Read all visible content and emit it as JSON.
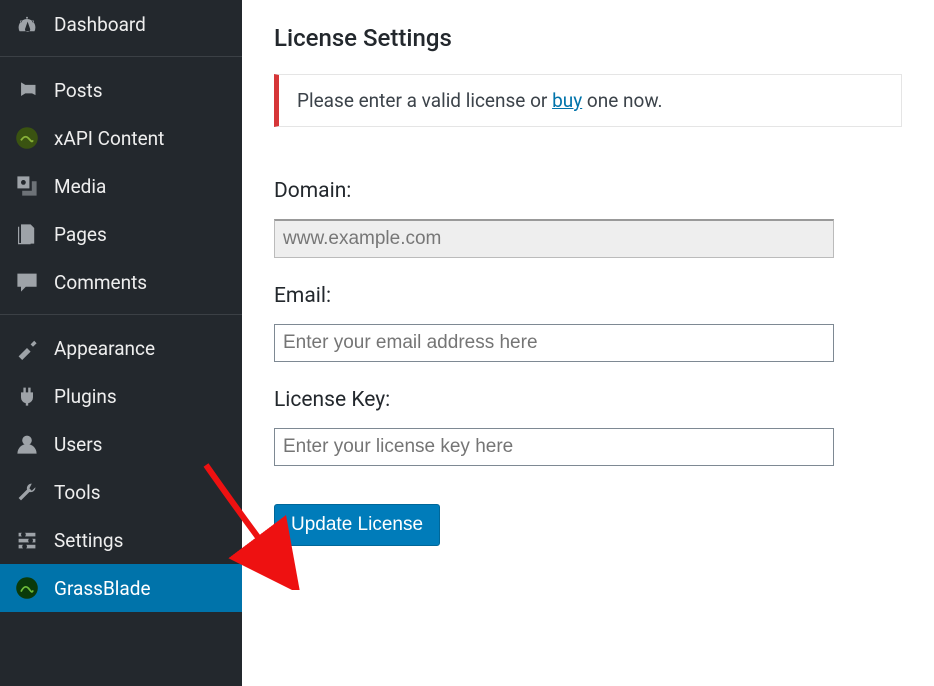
{
  "sidebar": {
    "items": [
      {
        "label": "Dashboard",
        "icon": "dashboard-icon"
      },
      {
        "label": "Posts",
        "icon": "pin-icon"
      },
      {
        "label": "xAPI Content",
        "icon": "xapi-icon"
      },
      {
        "label": "Media",
        "icon": "media-icon"
      },
      {
        "label": "Pages",
        "icon": "pages-icon"
      },
      {
        "label": "Comments",
        "icon": "comments-icon"
      },
      {
        "label": "Appearance",
        "icon": "appearance-icon"
      },
      {
        "label": "Plugins",
        "icon": "plugins-icon"
      },
      {
        "label": "Users",
        "icon": "users-icon"
      },
      {
        "label": "Tools",
        "icon": "tools-icon"
      },
      {
        "label": "Settings",
        "icon": "settings-icon"
      },
      {
        "label": "GrassBlade",
        "icon": "grassblade-icon"
      }
    ]
  },
  "page": {
    "title": "License Settings",
    "notice_before": "Please enter a valid license or ",
    "notice_link": "buy",
    "notice_after": " one now.",
    "domain_label": "Domain:",
    "domain_value": "www.example.com",
    "email_label": "Email:",
    "email_placeholder": "Enter your email address here",
    "key_label": "License Key:",
    "key_placeholder": "Enter your license key here",
    "button_label": "Update License"
  }
}
